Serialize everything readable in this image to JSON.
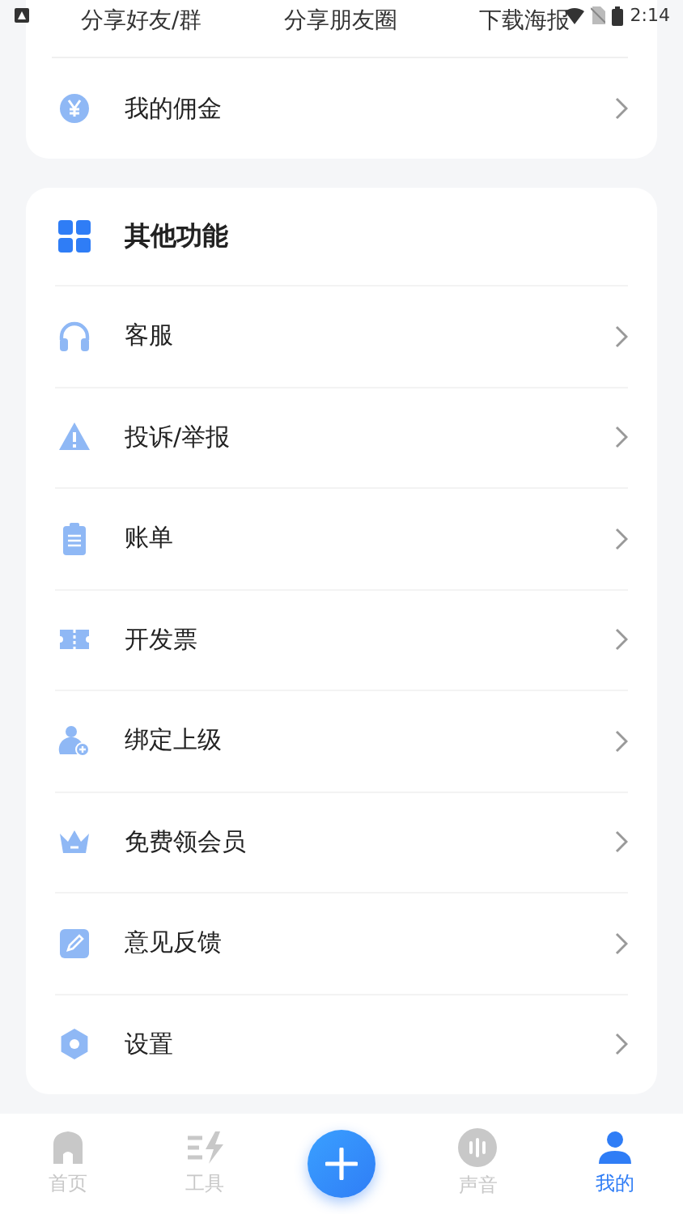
{
  "status_bar": {
    "time": "2:14"
  },
  "share_actions": [
    "分享好友/群",
    "分享朋友圈",
    "下载海报"
  ],
  "commission": {
    "label": "我的佣金"
  },
  "other_section": {
    "title": "其他功能",
    "items": [
      {
        "label": "客服"
      },
      {
        "label": "投诉/举报"
      },
      {
        "label": "账单"
      },
      {
        "label": "开发票"
      },
      {
        "label": "绑定上级"
      },
      {
        "label": "免费领会员"
      },
      {
        "label": "意见反馈"
      },
      {
        "label": "设置"
      }
    ]
  },
  "tab_bar": [
    {
      "kind": "tab",
      "label": "首页",
      "selected": false
    },
    {
      "kind": "tab",
      "label": "工具",
      "selected": false
    },
    {
      "kind": "fab"
    },
    {
      "kind": "tab",
      "label": "声音",
      "selected": false
    },
    {
      "kind": "tab",
      "label": "我的",
      "selected": true
    }
  ]
}
